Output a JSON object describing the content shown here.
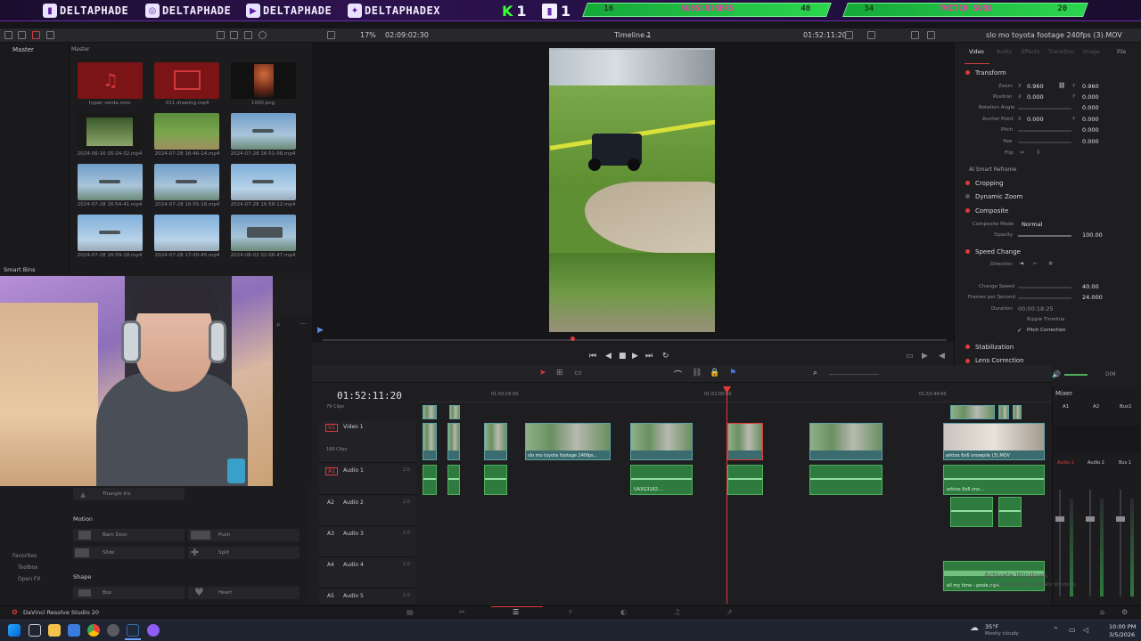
{
  "banner": {
    "socials": [
      {
        "icon": "twitch-icon",
        "handle": "DELTAPHADE"
      },
      {
        "icon": "instagram-icon",
        "handle": "DELTAPHADE"
      },
      {
        "icon": "youtube-icon",
        "handle": "DELTAPHADE"
      },
      {
        "icon": "twitter-icon",
        "handle": "DELTAPHADEX"
      }
    ],
    "kick_letter": "K",
    "kick_count": "1",
    "twitch_count": "1",
    "subs_goal": {
      "current": "16",
      "label": "SUBSCRIBERS",
      "target": "40"
    },
    "twitch_subs_goal": {
      "current": "34",
      "label": "TWITCH SUBS",
      "target": "20"
    }
  },
  "toolbar": {
    "zoom": "17%",
    "source_timecode": "02:09:02:30",
    "timeline_name": "Timeline 1",
    "record_timecode": "01:52:11:20",
    "clip_name": "slo mo toyota footage 240fps (3).MOV",
    "master_left": "Master",
    "master_right": "Master"
  },
  "media_pool": {
    "clips": [
      {
        "name": "hyper verde.mov",
        "thumb": "red"
      },
      {
        "name": "011 drawing.mp4",
        "thumb": "red"
      },
      {
        "name": "1000.png",
        "thumb": "dark"
      },
      {
        "name": "2024-06-16 05-24-32.mp4",
        "thumb": "grass"
      },
      {
        "name": "2024-07-28 16-46-14.mp4",
        "thumb": "grass"
      },
      {
        "name": "2024-07-28 16-51-08.mp4",
        "thumb": "sky"
      },
      {
        "name": "2024-07-28 16-54-41.mp4",
        "thumb": "sky"
      },
      {
        "name": "2024-07-28 16-55-18.mp4",
        "thumb": "sky"
      },
      {
        "name": "2024-07-28 16-58-12.mp4",
        "thumb": "sky2"
      },
      {
        "name": "2024-07-28 16-59-18.mp4",
        "thumb": "sky2"
      },
      {
        "name": "2024-07-28 17-00-45.mp4",
        "thumb": "sky2"
      },
      {
        "name": "2024-08-02 02-06-47.mp4",
        "thumb": "sky"
      }
    ],
    "smart_bins": "Smart Bins"
  },
  "inspector": {
    "tabs": [
      "Video",
      "Audio",
      "Effects",
      "Transition",
      "Image",
      "File"
    ],
    "transform": "Transform",
    "zoom_label": "Zoom",
    "zoom_x": "0.960",
    "zoom_y": "0.960",
    "position_label": "Position",
    "position_x": "0.000",
    "position_y": "0.000",
    "rotation_label": "Rotation Angle",
    "rotation": "0.000",
    "anchor_label": "Anchor Point",
    "anchor_x": "0.000",
    "anchor_y": "0.000",
    "pitch_label": "Pitch",
    "pitch": "0.000",
    "yaw_label": "Yaw",
    "yaw": "0.000",
    "flip_label": "Flip",
    "ai_reframe": "AI Smart Reframe",
    "cropping": "Cropping",
    "dynamic_zoom": "Dynamic Zoom",
    "composite": "Composite",
    "composite_mode_label": "Composite Mode",
    "composite_mode": "Normal",
    "opacity_label": "Opacity",
    "opacity": "100.00",
    "speed_change": "Speed Change",
    "direction_label": "Direction",
    "change_speed_label": "Change Speed",
    "change_speed": "40.00",
    "fps_label": "Frames per Second",
    "fps": "24.000",
    "duration_label": "Duration",
    "duration": "00:00:18:25",
    "ripple": "Ripple Timeline",
    "pitch_correction": "Pitch Correction",
    "stabilization": "Stabilization",
    "lens_correction": "Lens Correction"
  },
  "timeline": {
    "timecode": "01:52:11:20",
    "ruler": [
      "01:50:16:00",
      "01:52:00:00",
      "01:53:44:00"
    ],
    "tracks": [
      {
        "id": "V1",
        "name": "Video 1",
        "clips": "180 Clips"
      },
      {
        "id": "A1",
        "name": "Audio 1",
        "level": "2.0"
      },
      {
        "id": "A2",
        "name": "Audio 2",
        "level": "2.0"
      },
      {
        "id": "A3",
        "name": "Audio 3",
        "level": "2.0"
      },
      {
        "id": "A4",
        "name": "Audio 4",
        "level": "2.0"
      },
      {
        "id": "A5",
        "name": "Audio 5",
        "level": "2.0"
      }
    ],
    "v2_clips": "79 Clips",
    "clip_labels": [
      "slo mo toyota footage 240fps...",
      "UAXG3162....",
      "arktos 6x6 snowpile (3).MOV",
      "arktos 6x6 sno...",
      "all my time - posie.mp4"
    ]
  },
  "mixer": {
    "title": "Mixer",
    "channels": [
      "A1",
      "A2",
      "Bus1"
    ],
    "channel_names": [
      "Audio 1",
      "Audio 2",
      "Bus 1"
    ]
  },
  "effects": {
    "triangle_iris": "Triangle Iris",
    "motion": "Motion",
    "barn_door": "Barn Door",
    "push": "Push",
    "slide": "Slide",
    "split": "Split",
    "shape": "Shape",
    "box": "Box",
    "heart": "Heart",
    "favorites": "Favorites",
    "toolbox": "Toolbox",
    "open_fx": "Open FX"
  },
  "app_name": "DaVinci Resolve Studio 20",
  "dim": "DIM",
  "taskbar": {
    "weather_temp": "35°F",
    "weather_desc": "Mostly cloudy",
    "time": "10:00 PM",
    "date": "3/5/2026",
    "activate": "Activate Windows",
    "activate_sub": "Go to Settings to activate Windows."
  },
  "colors": {
    "accent_purple": "#6a2ea8",
    "goal_green": "#2cd44f",
    "playhead_red": "#e03a3a",
    "audio_green": "#2f7a3e",
    "video_teal": "#3a6b6e"
  }
}
